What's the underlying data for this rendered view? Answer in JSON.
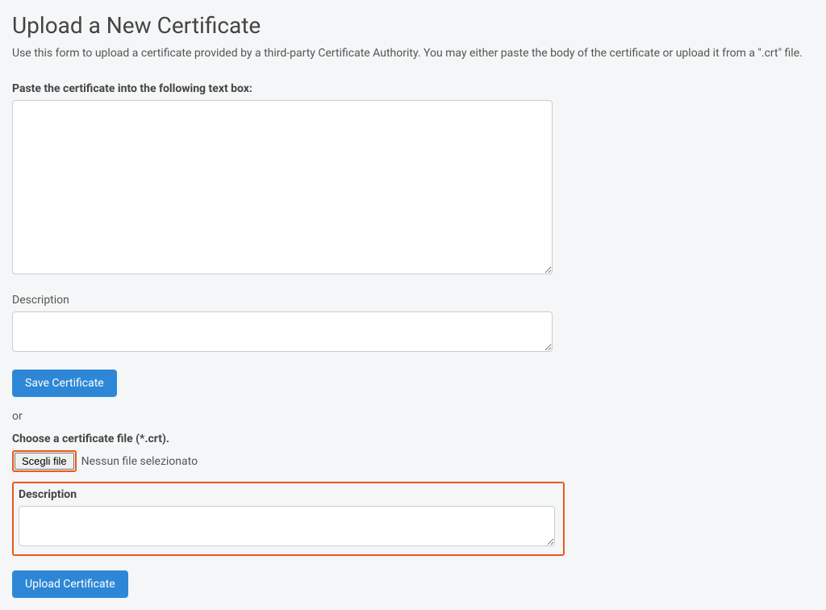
{
  "header": {
    "title": "Upload a New Certificate",
    "subtitle": "Use this form to upload a certificate provided by a third-party Certificate Authority. You may either paste the body of the certificate or upload it from a \".crt\" file."
  },
  "paste_section": {
    "label": "Paste the certificate into the following text box:",
    "description_label": "Description",
    "save_button": "Save Certificate"
  },
  "or_text": "or",
  "upload_section": {
    "label": "Choose a certificate file (*.crt).",
    "file_button": "Scegli file",
    "file_status": "Nessun file selezionato",
    "description_label": "Description",
    "upload_button": "Upload Certificate"
  }
}
